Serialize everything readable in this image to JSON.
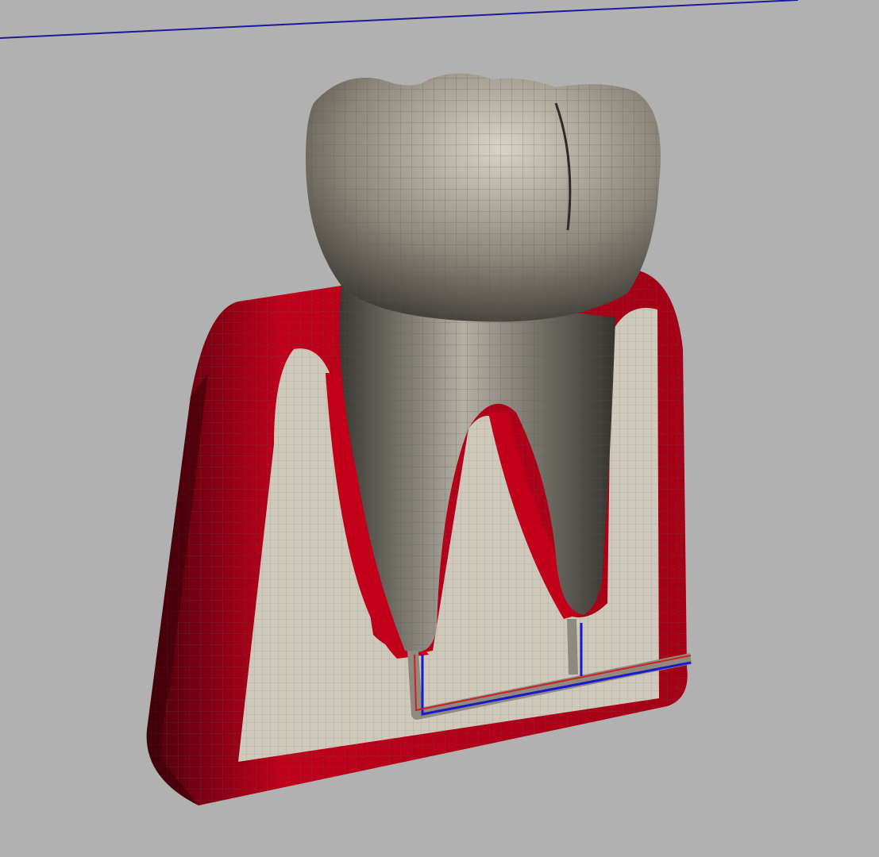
{
  "viewport": {
    "background": "#b1b1b1",
    "grid_line_color": "#1a1a9a"
  },
  "model": {
    "tooth_color": "#7f7a6e",
    "tooth_highlight": "#c9c4b8",
    "gum_color": "#c8001c",
    "gum_dark": "#5a0010",
    "bone_color": "#cfc9bb",
    "wireframe_color": "#6a6a6a",
    "nerve_colors": [
      "#1a1acc",
      "#cc2222"
    ],
    "icons": [
      "tooth-model-icon"
    ]
  }
}
